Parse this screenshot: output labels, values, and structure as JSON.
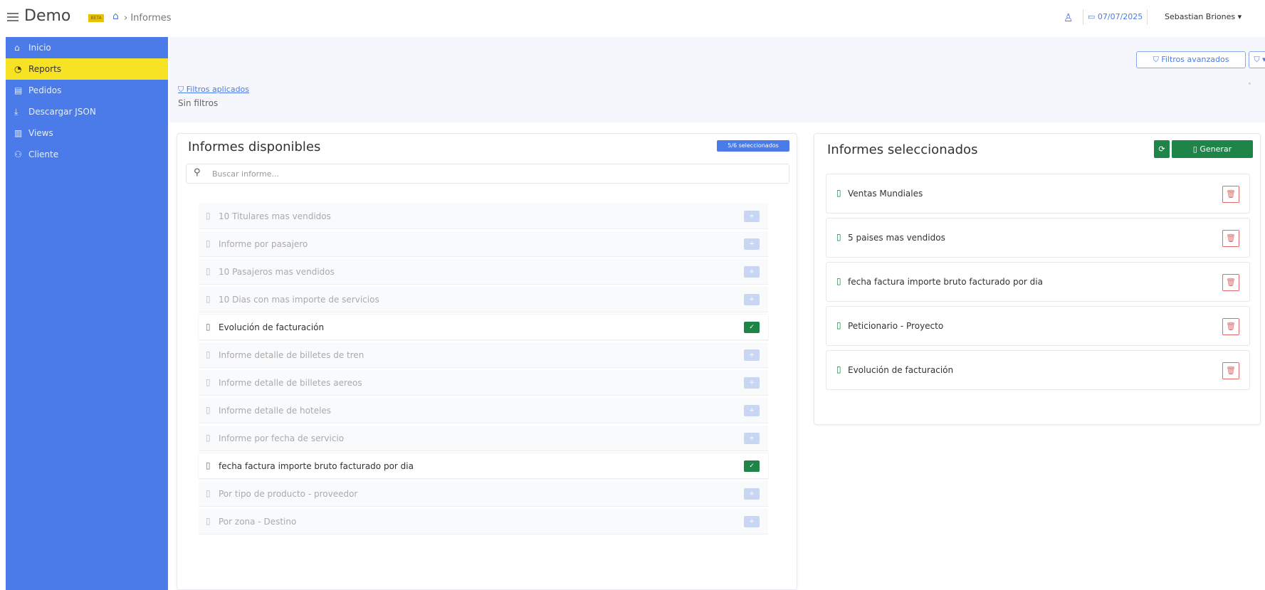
{
  "header": {
    "brand": "Demo",
    "badge": "BETA",
    "breadcrumb": "Informes",
    "date": "07/07/2025",
    "user": "Sebastian Briones"
  },
  "sidebar": {
    "items": [
      {
        "label": "Inicio",
        "icon": "home-icon"
      },
      {
        "label": "Reports",
        "icon": "reports-icon",
        "active": true
      },
      {
        "label": "Pedidos",
        "icon": "document-icon"
      },
      {
        "label": "Descargar JSON",
        "icon": "download-icon"
      },
      {
        "label": "Views",
        "icon": "chart-icon"
      },
      {
        "label": "Cliente",
        "icon": "user-icon"
      }
    ]
  },
  "filters": {
    "advanced_label": "Filtros avanzados",
    "filter_icon_label": "▾",
    "applied_link": "Filtros aplicados",
    "empty_text": "Sin filtros"
  },
  "available": {
    "title": "Informes disponibles",
    "selected_badge": "5/6 seleccionados",
    "search_placeholder": "Buscar informe...",
    "items": [
      {
        "label": "10 Titulares mas vendidos",
        "selected": false
      },
      {
        "label": "Informe por pasajero",
        "selected": false
      },
      {
        "label": "10 Pasajeros mas vendidos",
        "selected": false
      },
      {
        "label": "10 Dias con mas importe de servicios",
        "selected": false
      },
      {
        "label": "Evolución de facturación",
        "selected": true
      },
      {
        "label": "Informe detalle de billetes de tren",
        "selected": false
      },
      {
        "label": "Informe detalle de billetes aereos",
        "selected": false
      },
      {
        "label": "Informe detalle de hoteles",
        "selected": false
      },
      {
        "label": "Informe por fecha de servicio",
        "selected": false
      },
      {
        "label": "fecha factura importe bruto facturado por dia",
        "selected": true
      },
      {
        "label": "Por tipo de producto - proveedor",
        "selected": false
      },
      {
        "label": "Por zona - Destino",
        "selected": false
      }
    ]
  },
  "selected": {
    "title": "Informes seleccionados",
    "generate_label": "Generar",
    "items": [
      {
        "label": "Ventas Mundiales"
      },
      {
        "label": "5 paises mas vendidos"
      },
      {
        "label": "fecha factura importe bruto facturado por dia"
      },
      {
        "label": "Peticionario - Proyecto"
      },
      {
        "label": "Evolución de facturación"
      }
    ]
  },
  "colors": {
    "sidebar": "#4a7be8",
    "active_item": "#f7e223",
    "success": "#1f8447",
    "danger": "#e06a6a"
  }
}
